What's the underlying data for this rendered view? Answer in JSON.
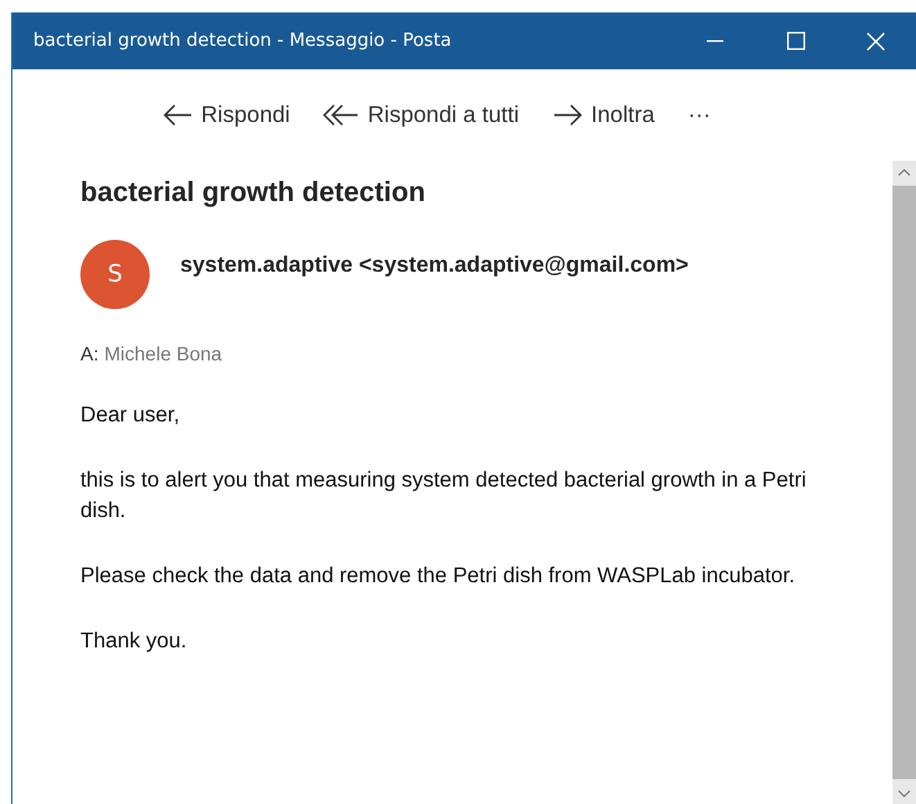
{
  "window": {
    "title": "bacterial growth detection - Messaggio - Posta"
  },
  "toolbar": [
    {
      "kind": "reply",
      "label": "Rispondi"
    },
    {
      "kind": "reply_all",
      "label": "Rispondi a tutti"
    },
    {
      "kind": "forward",
      "label": "Inoltra"
    },
    {
      "kind": "more",
      "label": "···"
    }
  ],
  "message": {
    "subject": "bacterial growth detection",
    "avatar": {
      "initial": "S",
      "color": "#dd5431"
    },
    "sender": "system.adaptive <system.adaptive@gmail.com>",
    "to_label": "A:",
    "to": "Michele Bona",
    "body": [
      "Dear user,",
      "this is to alert you that measuring system detected bacterial growth in a Petri dish.",
      "Please check the data and remove the Petri dish from WASPLab incubator.",
      "Thank you."
    ]
  }
}
